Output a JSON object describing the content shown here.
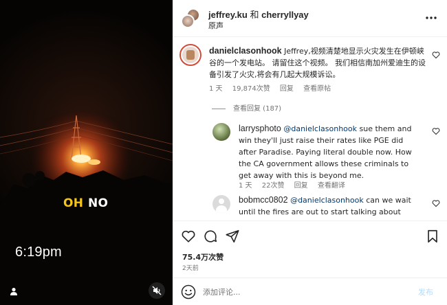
{
  "video": {
    "caption_highlight": "OH",
    "caption_rest": "NO",
    "timestamp": "6:19pm",
    "icons": [
      "user-tag-icon",
      "mute-icon"
    ],
    "caption_color": "#f5c518"
  },
  "header": {
    "user1": "jeffrey.ku",
    "conjunction": "和",
    "user2": "cherryllyay",
    "audio": "原声"
  },
  "comments": [
    {
      "username": "danielclasonhook",
      "text": "Jeffrey,视频清楚地显示火灾发生在伊顿峡谷的一个发电站。 请留住这个视频。 我们相信南加州爱迪生的设备引发了火灾,将会有几起大规模诉讼。",
      "time": "1 天",
      "likes": "19,874次赞",
      "reply": "回复",
      "translate": "查看原帖",
      "view_replies": "查看回复 (187)",
      "replies": [
        {
          "username": "larrysphoto",
          "mention": "@danielclasonhook",
          "text": "sue them and win they'll just raise their rates like PGE did after Paradise. Paying literal double now. How the CA government allows these criminals to get away with this is beyond me.",
          "time": "1 天",
          "likes": "22次赞",
          "reply": "回复",
          "translate": "查看翻译"
        },
        {
          "username": "bobmcc0802",
          "mention": "@danielclasonhook",
          "text": "can we wait until the fires are out to start talking about suing people and making money off of this?"
        }
      ]
    }
  ],
  "actions": {
    "likes": "75.4万次赞",
    "posted": "2天前",
    "icons": [
      "heart-icon",
      "comment-icon",
      "share-icon",
      "bookmark-icon"
    ]
  },
  "composer": {
    "placeholder": "添加评论...",
    "post_label": "发布"
  },
  "colors": {
    "mention": "#00376b",
    "post_button": "#b3dbff",
    "muted_text": "#737373"
  }
}
